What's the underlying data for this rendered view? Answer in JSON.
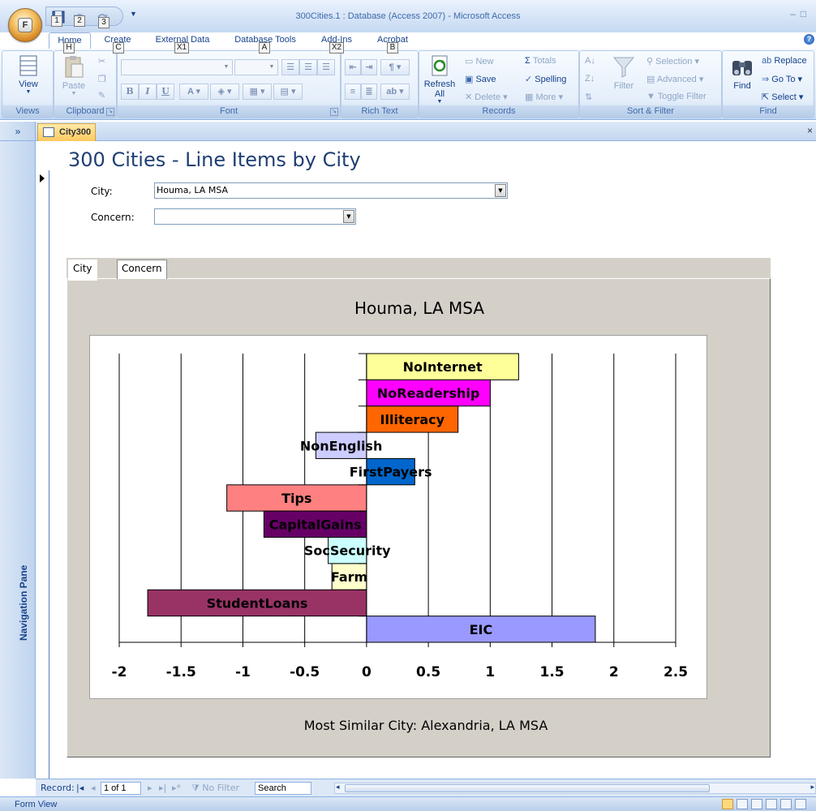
{
  "window": {
    "title": "300Cities.1 : Database (Access 2007) - Microsoft Access",
    "office_key": "F",
    "qat_keys": [
      "1",
      "2",
      "3"
    ]
  },
  "ribbon": {
    "tabs": [
      {
        "label": "Home",
        "key": "H",
        "active": true
      },
      {
        "label": "Create",
        "key": "C"
      },
      {
        "label": "External Data",
        "key": "X1"
      },
      {
        "label": "Database Tools",
        "key": "A"
      },
      {
        "label": "Add-Ins",
        "key": "X2"
      },
      {
        "label": "Acrobat",
        "key": "B"
      }
    ],
    "groups": {
      "views": {
        "label": "Views",
        "view": "View"
      },
      "clipboard": {
        "label": "Clipboard",
        "paste": "Paste"
      },
      "font": {
        "label": "Font",
        "bold": "B",
        "italic": "I",
        "underline": "U",
        "font_color": "A"
      },
      "rich_text": {
        "label": "Rich Text"
      },
      "records": {
        "label": "Records",
        "refresh": "Refresh All",
        "new": "New",
        "save": "Save",
        "delete": "Delete",
        "totals": "Totals",
        "spelling": "Spelling",
        "more": "More"
      },
      "sort_filter": {
        "label": "Sort & Filter",
        "filter": "Filter",
        "selection": "Selection",
        "advanced": "Advanced",
        "toggle_filter": "Toggle Filter"
      },
      "find": {
        "label": "Find",
        "find": "Find",
        "replace": "Replace",
        "goto": "Go To",
        "select": "Select"
      }
    }
  },
  "nav_pane": {
    "expand": "»",
    "label": "Navigation Pane"
  },
  "document_tab": {
    "label": "City300",
    "close": "×"
  },
  "form": {
    "title": "300 Cities - Line Items by City",
    "city_label": "City:",
    "city_value": "Houma, LA MSA",
    "concern_label": "Concern:",
    "concern_value": "",
    "tabs": [
      {
        "label": "City",
        "active": true
      },
      {
        "label": "Concern",
        "active": false
      }
    ],
    "chart_title": "Houma, LA MSA",
    "similar_city": "Most Similar City: Alexandria, LA MSA"
  },
  "chart_data": {
    "type": "bar",
    "orientation": "horizontal",
    "title": "Houma, LA MSA",
    "xlim": [
      -2,
      2.5
    ],
    "xticks": [
      "-2",
      "-1.5",
      "-1",
      "-0.5",
      "0",
      "0.5",
      "1",
      "1.5",
      "2",
      "2.5"
    ],
    "grid": true,
    "categories": [
      "NoInternet",
      "NoReadership",
      "Illiteracy",
      "NonEnglish",
      "FirstPayers",
      "Tips",
      "CapitalGains",
      "SocSecurity",
      "Farm",
      "StudentLoans",
      "EIC"
    ],
    "values": [
      1.23,
      1.0,
      0.74,
      -0.41,
      0.39,
      -1.13,
      -0.83,
      -0.31,
      -0.28,
      -1.77,
      1.85
    ],
    "colors": [
      "#ffff99",
      "#ff00ff",
      "#ff6600",
      "#ccccff",
      "#0066cc",
      "#ff8080",
      "#660066",
      "#ccffff",
      "#ffffcc",
      "#993366",
      "#9999ff"
    ]
  },
  "record_nav": {
    "label": "Record:",
    "current": "1 of 1",
    "no_filter": "No Filter",
    "search": "Search"
  },
  "status": {
    "text": "Form View"
  }
}
